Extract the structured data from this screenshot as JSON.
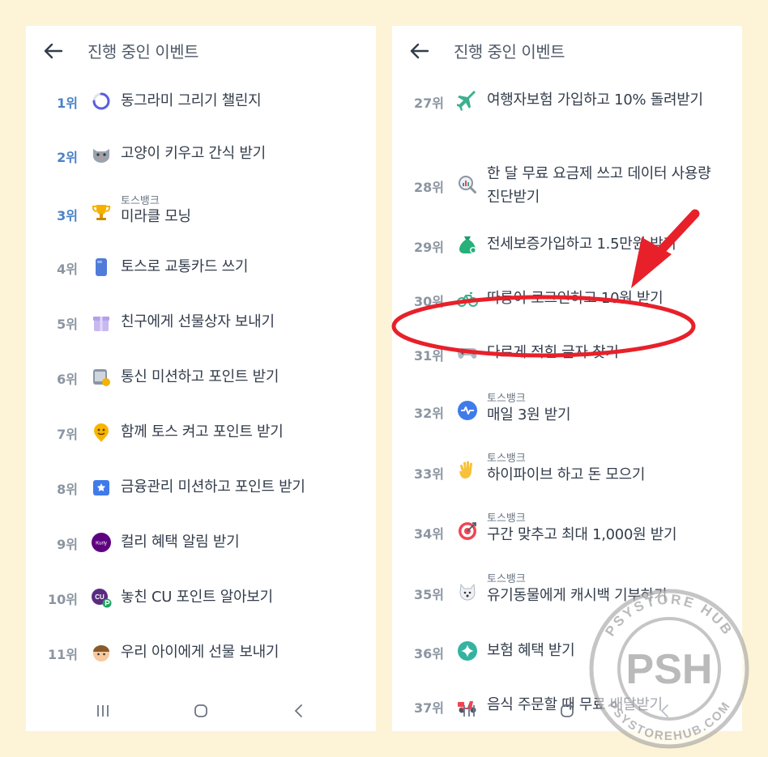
{
  "left_panel": {
    "title": "진행 중인 이벤트",
    "items": [
      {
        "rank": "1위",
        "title": "동그라미 그리기 챌린지",
        "icon": "circle-loader-icon"
      },
      {
        "rank": "2위",
        "title": "고양이 키우고 간식 받기",
        "icon": "cat-face-icon"
      },
      {
        "rank": "3위",
        "subtitle": "토스뱅크",
        "title": "미라클 모닝",
        "icon": "trophy-icon"
      },
      {
        "rank": "4위",
        "title": "토스로 교통카드 쓰기",
        "icon": "card-icon"
      },
      {
        "rank": "5위",
        "title": "친구에게 선물상자 보내기",
        "icon": "gift-icon"
      },
      {
        "rank": "6위",
        "title": "통신 미션하고 포인트 받기",
        "icon": "phone-coin-icon"
      },
      {
        "rank": "7위",
        "title": "함께 토스 켜고 포인트 받기",
        "icon": "smile-pin-icon"
      },
      {
        "rank": "8위",
        "title": "금융관리 미션하고 포인트 받기",
        "icon": "calendar-star-icon"
      },
      {
        "rank": "9위",
        "title": "컬리 혜택 알림 받기",
        "icon": "kurly-logo-icon",
        "icon_text": "Kurly"
      },
      {
        "rank": "10위",
        "title": "놓친 CU 포인트 알아보기",
        "icon": "cu-point-icon",
        "icon_text": "CU"
      },
      {
        "rank": "11위",
        "title": "우리 아이에게 선물 보내기",
        "icon": "kid-face-icon"
      }
    ]
  },
  "right_panel": {
    "title": "진행 중인 이벤트",
    "items": [
      {
        "rank": "27위",
        "title": "여행자보험 가입하고 10% 돌려받기",
        "icon": "airplane-icon"
      },
      {
        "rank": "28위",
        "title": "한 달 무료 요금제 쓰고 데이터 사용량 진단받기",
        "icon": "magnifier-chart-icon"
      },
      {
        "rank": "29위",
        "title": "전세보증가입하고 1.5만원 받기",
        "icon": "money-bag-icon"
      },
      {
        "rank": "30위",
        "title": "따릉이 로그인하고 10원 받기",
        "icon": "bicycle-icon"
      },
      {
        "rank": "31위",
        "title": "다르게 적힌 글자 찾기",
        "icon": "gamepad-icon"
      },
      {
        "rank": "32위",
        "subtitle": "토스뱅크",
        "title": "매일 3원 받기",
        "icon": "pulse-coin-icon"
      },
      {
        "rank": "33위",
        "subtitle": "토스뱅크",
        "title": "하이파이브 하고 돈 모으기",
        "icon": "waving-hand-icon"
      },
      {
        "rank": "34위",
        "subtitle": "토스뱅크",
        "title": "구간 맞추고 최대 1,000원 받기",
        "icon": "target-icon"
      },
      {
        "rank": "35위",
        "subtitle": "토스뱅크",
        "title": "유기동물에게 캐시백 기부하기",
        "icon": "dog-face-icon"
      },
      {
        "rank": "36위",
        "title": "보험 혜택 받기",
        "icon": "sparkle-icon"
      },
      {
        "rank": "37위",
        "title": "음식 주문할 때 무료 배달받기",
        "icon": "scooter-icon"
      }
    ]
  },
  "watermark": {
    "top_text": "PSYSTORE HUB",
    "center_text": "PSH",
    "bottom_text": "PSYSTOREHUB.COM"
  },
  "colors": {
    "background": "#fdf3d6",
    "panel": "#ffffff",
    "top_rank": "#4a82c8",
    "rank": "#8b95a1",
    "title": "#333d4b",
    "annotation": "#e8202a"
  }
}
